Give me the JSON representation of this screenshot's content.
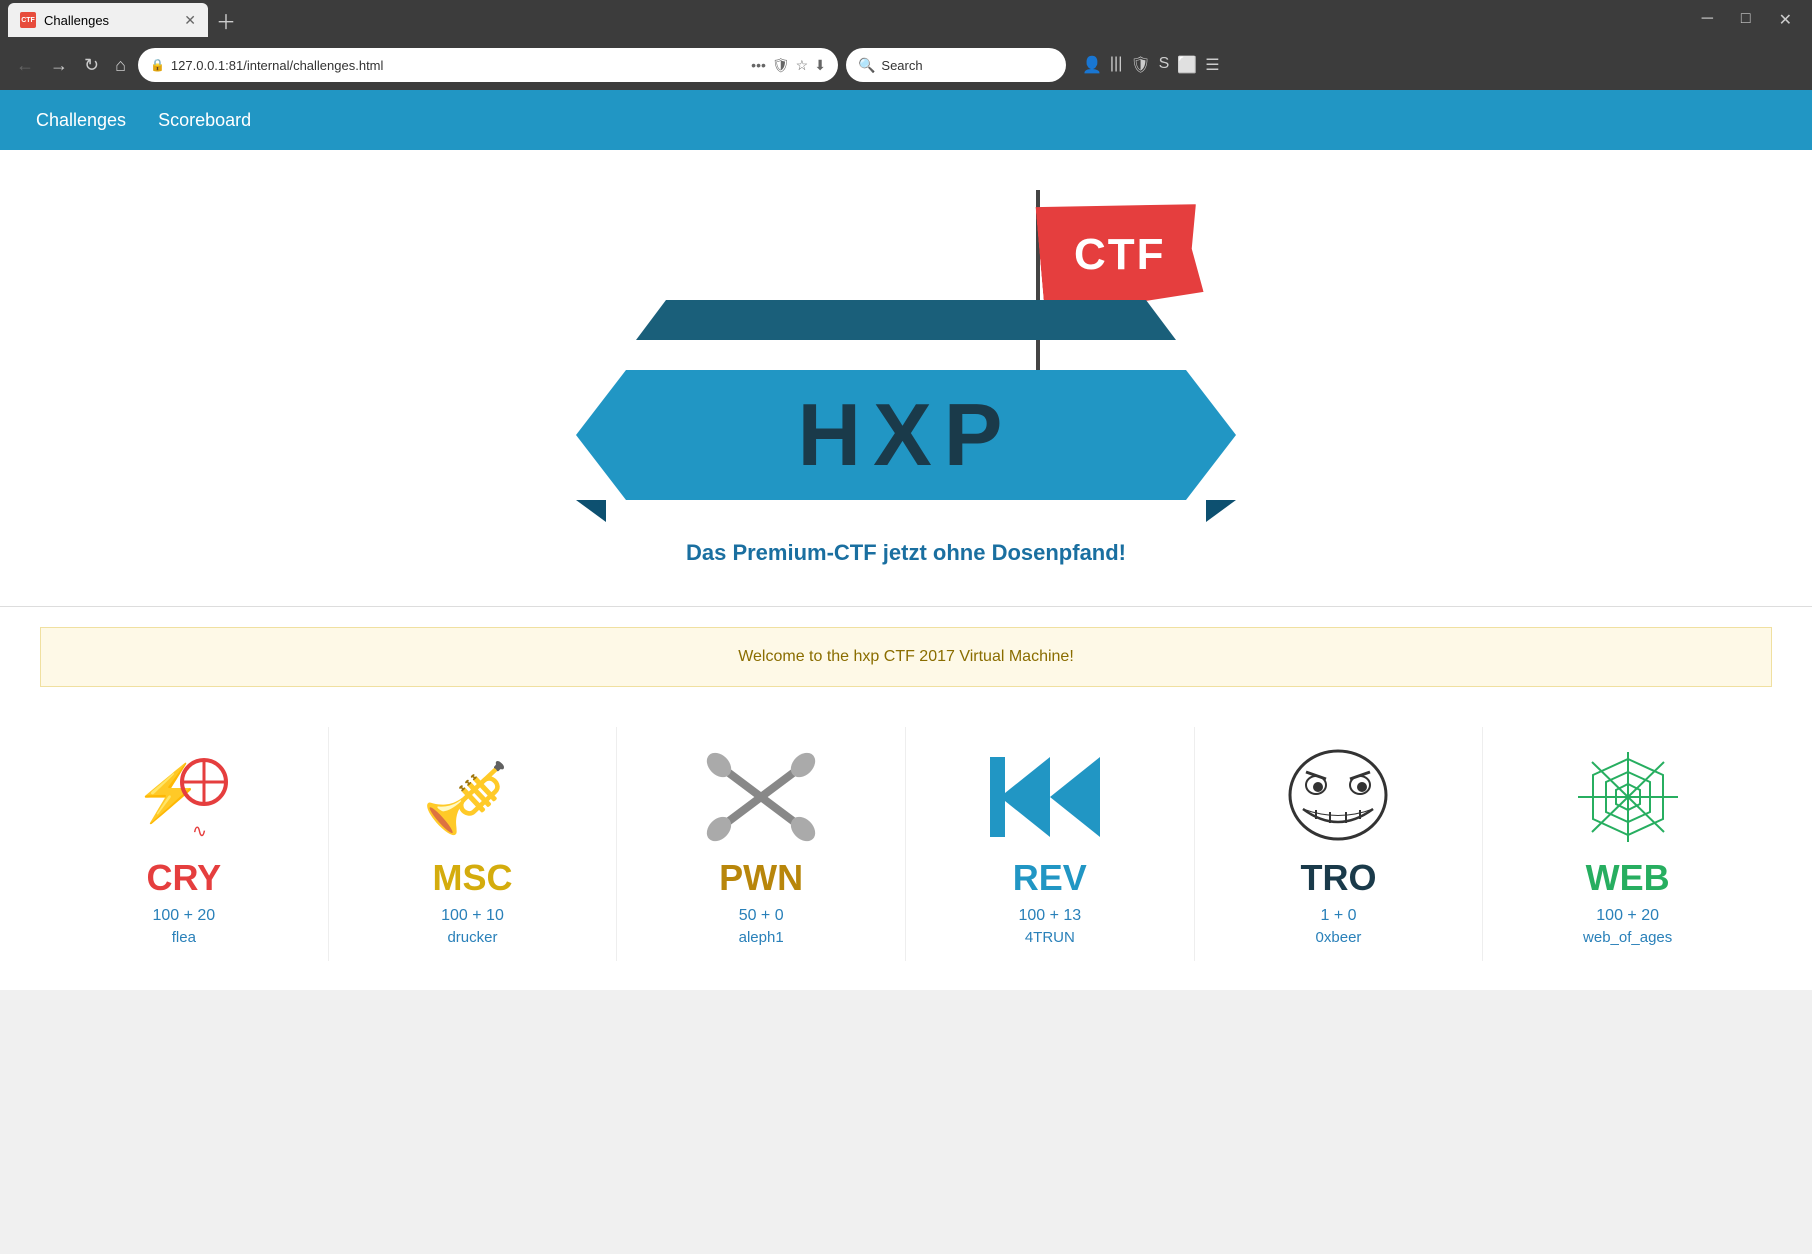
{
  "browser": {
    "tab_title": "Challenges",
    "tab_icon": "CTF",
    "url": "127.0.0.1:81/internal/challenges.html",
    "search_placeholder": "Search",
    "search_value": ""
  },
  "nav": {
    "links": [
      {
        "label": "Challenges",
        "href": "#"
      },
      {
        "label": "Scoreboard",
        "href": "#"
      }
    ]
  },
  "hero": {
    "logo_text": "HXP",
    "flag_text": "CTF",
    "tagline": "Das Premium-CTF jetzt ohne Dosenpfand!"
  },
  "welcome": {
    "message": "Welcome to the hxp CTF 2017 Virtual Machine!"
  },
  "challenges": [
    {
      "id": "cry",
      "name": "CRY",
      "color": "#e53e3e",
      "score": "100 + 20",
      "link": "flea"
    },
    {
      "id": "msc",
      "name": "MSC",
      "color": "#d4ac0d",
      "score": "100 + 10",
      "link": "drucker"
    },
    {
      "id": "pwn",
      "name": "PWN",
      "color": "#b8860b",
      "score": "50 + 0",
      "link": "aleph1"
    },
    {
      "id": "rev",
      "name": "REV",
      "color": "#2196c4",
      "score": "100 + 13",
      "link": "4TRUN"
    },
    {
      "id": "tro",
      "name": "TRO",
      "color": "#1a3a4a",
      "score": "1 + 0",
      "link": "0xbeer"
    },
    {
      "id": "web",
      "name": "WEB",
      "color": "#27ae60",
      "score": "100 + 20",
      "link": "web_of_ages"
    }
  ]
}
